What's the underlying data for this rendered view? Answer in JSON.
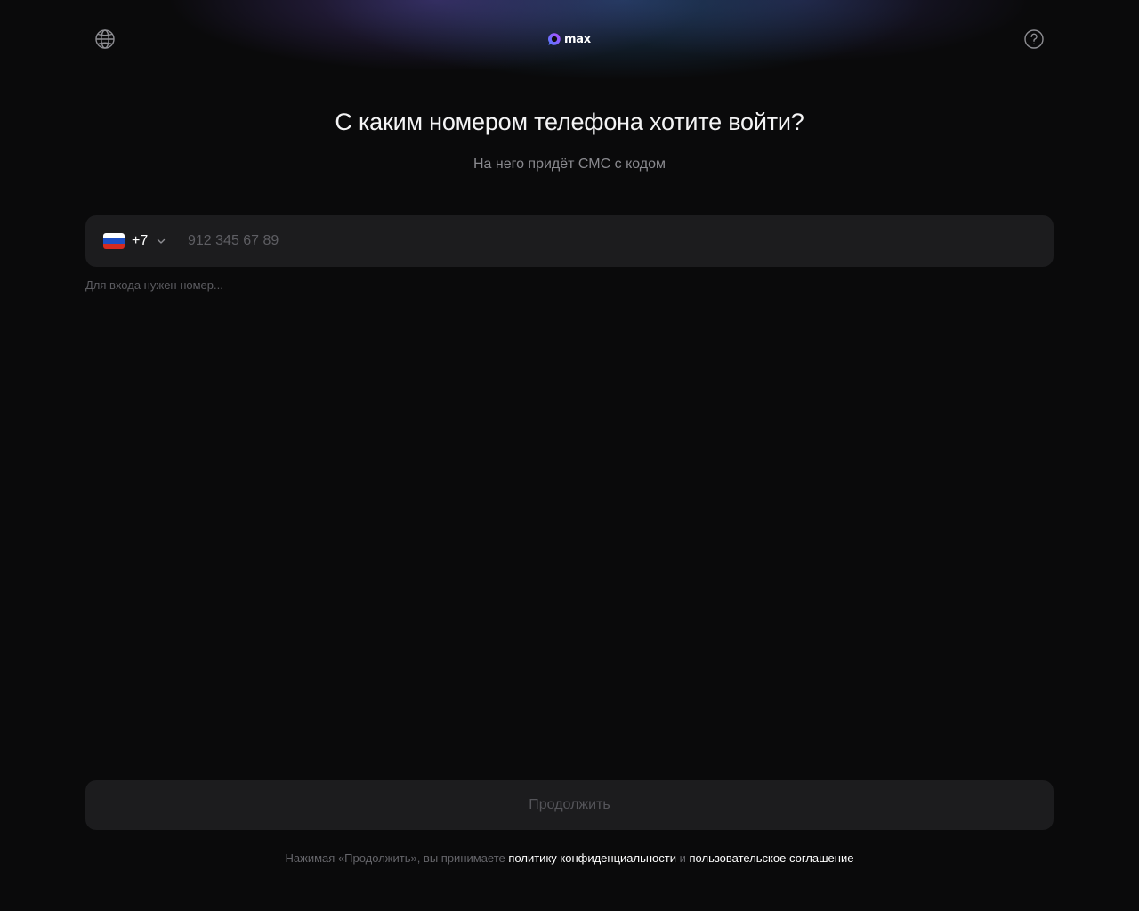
{
  "app": {
    "logo_text": "max",
    "colors": {
      "background": "#0a0a0b",
      "field_background": "#1c1c1e",
      "logo_gradient_start": "#5b6cff",
      "logo_gradient_end": "#b14dff"
    }
  },
  "header": {
    "language_icon": "globe-icon",
    "help_icon": "help-circle-icon"
  },
  "main": {
    "title": "С каким номером телефона хотите войти?",
    "subtitle": "На него придёт СМС с кодом",
    "phone": {
      "country_flag": "russia-flag",
      "country_code": "+7",
      "value": "",
      "placeholder": "912 345 67 89"
    },
    "hint": "Для входа нужен номер..."
  },
  "footer": {
    "continue_label": "Продолжить",
    "legal_prefix": "Нажимая «Продолжить», вы принимаете ",
    "privacy_link": "политику конфиденциальности",
    "legal_and": " и ",
    "terms_link": "пользовательское соглашение"
  }
}
